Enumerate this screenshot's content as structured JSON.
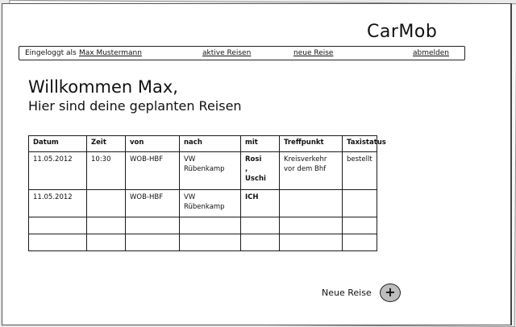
{
  "brand": "CarMob",
  "nav": {
    "logged_in_label": "Eingeloggt als",
    "user_name": "Max Mustermann",
    "active_trips": "aktive Reisen",
    "new_trip": "neue Reise",
    "logout": "abmelden"
  },
  "welcome": "Willkommen Max,",
  "subtitle": "Hier sind deine geplanten Reisen",
  "table": {
    "headers": [
      "Datum",
      "Zeit",
      "von",
      "nach",
      "mit",
      "Treffpunkt",
      "Taxistatus"
    ],
    "rows": [
      {
        "datum": "11.05.2012",
        "zeit": "10:30",
        "von": "WOB-HBF",
        "nach": "VW\nRübenkamp",
        "mit": "Rosi\n,\nUschi",
        "treffpunkt": "Kreisverkehr\nvor dem Bhf",
        "taxistatus": "bestellt"
      },
      {
        "datum": "11.05.2012",
        "zeit": "",
        "von": "WOB-HBF",
        "nach": "VW\nRübenkamp",
        "mit": "ICH",
        "treffpunkt": "",
        "taxistatus": ""
      }
    ]
  },
  "footer": {
    "new_trip_label": "Neue Reise",
    "add_icon": "+"
  }
}
